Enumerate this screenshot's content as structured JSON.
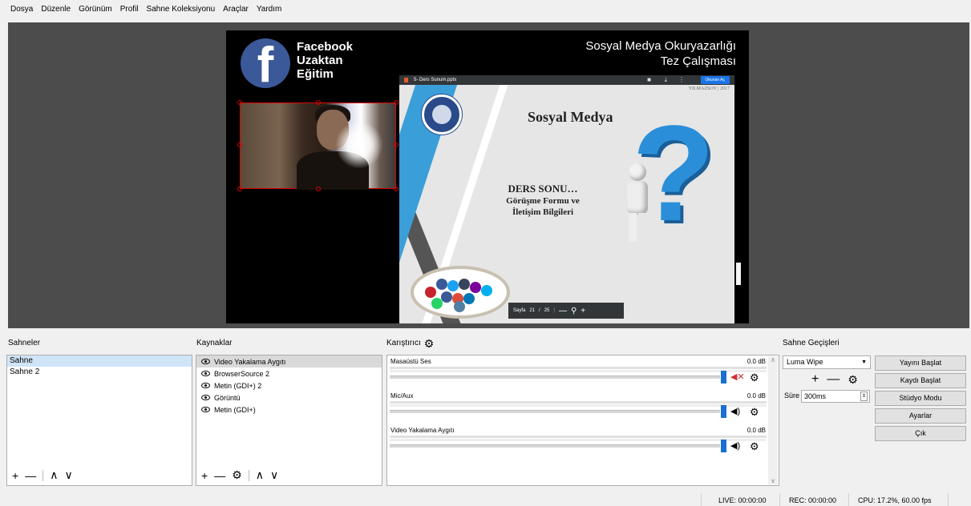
{
  "menu": [
    "Dosya",
    "Düzenle",
    "Görünüm",
    "Profil",
    "Sahne Koleksiyonu",
    "Araçlar",
    "Yardım"
  ],
  "preview": {
    "fb_logo": "f",
    "fb_lines": [
      "Facebook",
      "Uzaktan",
      "Eğitim"
    ],
    "title_lines": [
      "Sosyal Medya Okuryazarlığı",
      "Tez Çalışması"
    ],
    "slide": {
      "file": "5- Ders Sunum.pptx",
      "open_button": "Okunan Aç",
      "author": "YILMAZSOY | 2017",
      "heading": "Sosyal Medya",
      "body_line1": "DERS SONU…",
      "body_line2": "Görüşme Formu ve",
      "body_line3": "İletişim Bilgileri",
      "nav_label": "Sayfa",
      "nav_page": "21",
      "nav_sep": "/",
      "nav_total": "25",
      "question_mark": "?"
    }
  },
  "scenes": {
    "title": "Sahneler",
    "items": [
      "Sahne",
      "Sahne 2"
    ]
  },
  "sources": {
    "title": "Kaynaklar",
    "items": [
      "Video Yakalama Aygıtı",
      "BrowserSource 2",
      "Metin (GDI+) 2",
      "Görüntü",
      "Metin (GDI+)"
    ]
  },
  "mixer": {
    "title": "Karıştırıcı",
    "channels": [
      {
        "name": "Masaüstü Ses",
        "db": "0.0 dB",
        "muted": true
      },
      {
        "name": "Mic/Aux",
        "db": "0.0 dB",
        "muted": false
      },
      {
        "name": "Video Yakalama Aygıtı",
        "db": "0.0 dB",
        "muted": false
      }
    ]
  },
  "transitions": {
    "title": "Sahne Geçişleri",
    "selected": "Luma Wipe",
    "duration_label": "Süre",
    "duration_value": "300ms"
  },
  "controls": [
    "Yayını Başlat",
    "Kaydı Başlat",
    "Stüdyo Modu",
    "Ayarlar",
    "Çık"
  ],
  "status": {
    "live": "LIVE: 00:00:00",
    "rec": "REC: 00:00:00",
    "cpu": "CPU: 17.2%, 60.00 fps"
  },
  "colors": {
    "preview_bg": "#4c4c4c",
    "accent": "#1a6fd1",
    "mute": "#d32f2f",
    "facebook": "#3b5998"
  }
}
